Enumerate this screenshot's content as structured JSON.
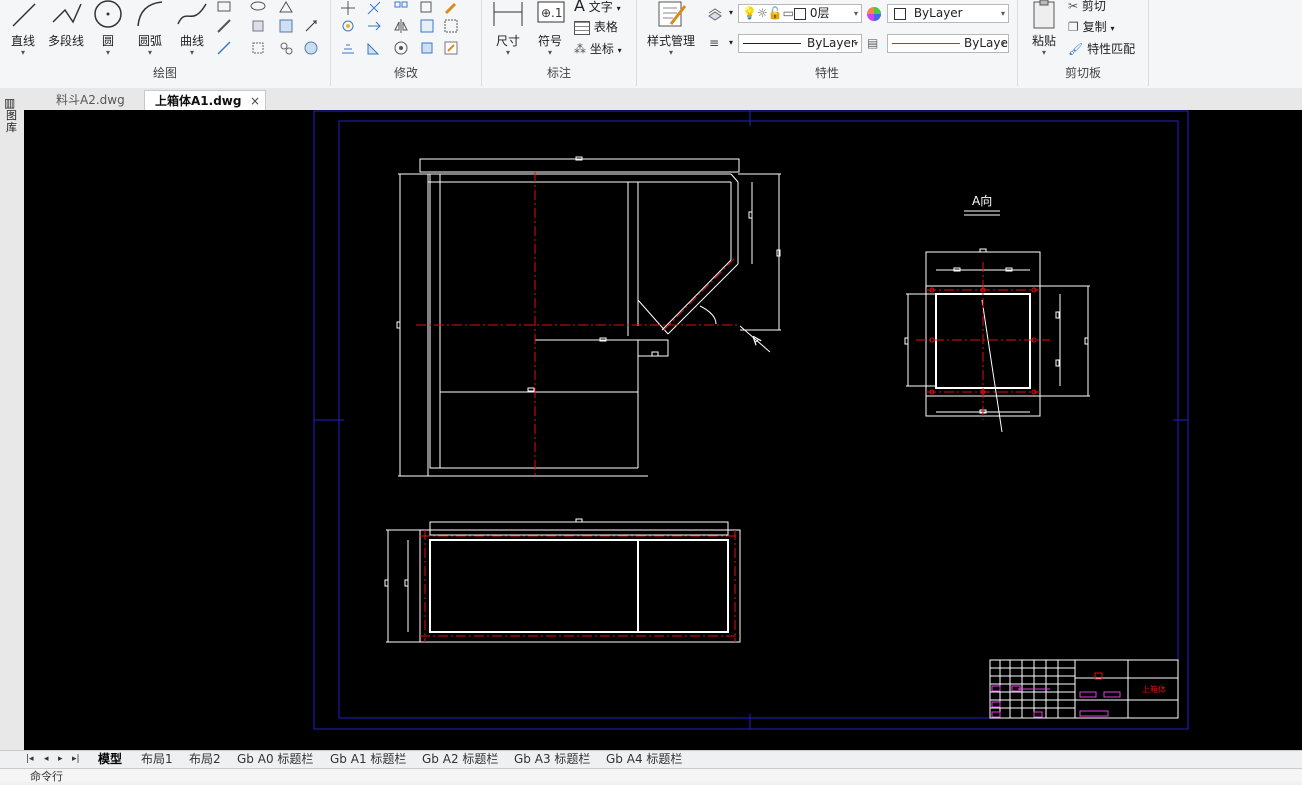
{
  "ribbon": {
    "draw": {
      "label": "绘图",
      "line": "直线",
      "polyline": "多段线",
      "circle": "圆",
      "arc": "圆弧",
      "curve": "曲线"
    },
    "modify": {
      "label": "修改"
    },
    "annotate": {
      "label": "标注",
      "dimension": "尺寸",
      "symbol": "符号",
      "text": "文字",
      "table": "表格",
      "coordinate": "坐标"
    },
    "properties": {
      "label": "特性",
      "style_manager": "样式管理",
      "layer_value": "0层",
      "color_value": "ByLayer",
      "linetype_value": "ByLayer",
      "lineweight_value": "ByLaye"
    },
    "clipboard": {
      "label": "剪切板",
      "paste": "粘贴",
      "cut": "剪切",
      "copy": "复制",
      "match": "特性匹配"
    }
  },
  "doc_tabs": [
    {
      "label": "料斗A2.dwg",
      "active": false
    },
    {
      "label": "上箱体A1.dwg",
      "active": true
    }
  ],
  "doc_tab_close": "×",
  "sidebar": {
    "label": "图库"
  },
  "drawing": {
    "view_label": "A向",
    "section_mark": "A",
    "title_block_text": "上箱体"
  },
  "layout_tabs": [
    "模型",
    "布局1",
    "布局2",
    "Gb A0 标题栏",
    "Gb A1 标题栏",
    "Gb A2 标题栏",
    "Gb A3 标题栏",
    "Gb A4 标题栏"
  ],
  "layout_nav": [
    "|◂",
    "◂",
    "▸",
    "▸|"
  ],
  "command_prompt": "命令行",
  "colors": {
    "canvas_bg": "#000000",
    "frame_blue": "#2020c8",
    "geometry": "#ffffff",
    "centerline": "#e01010",
    "title_block_magenta": "#e040e0",
    "linetype_red": "#e02020"
  }
}
